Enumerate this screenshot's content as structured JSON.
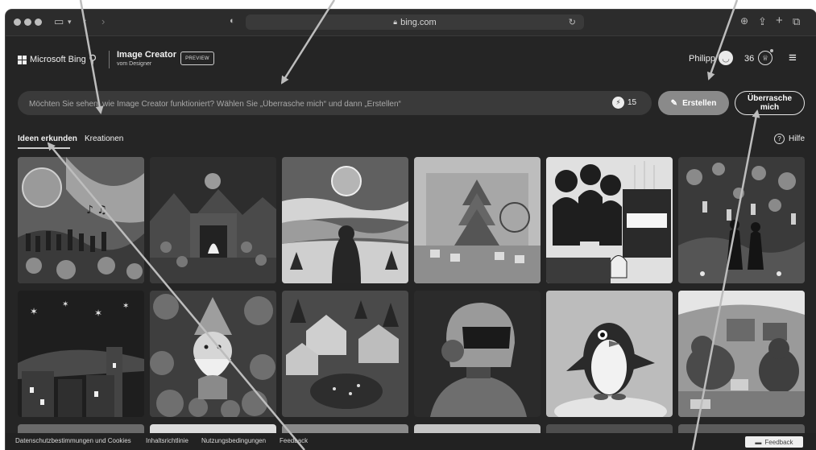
{
  "browser": {
    "url": "bing.com"
  },
  "header": {
    "brand": "Microsoft Bing",
    "product_title": "Image Creator",
    "product_subtitle": "vom Designer",
    "badge": "PREVIEW",
    "user_name": "Philipp",
    "points": "36"
  },
  "prompt": {
    "placeholder": "Möchten Sie sehen, wie Image Creator funktioniert? Wählen Sie „Überrasche mich“ und dann „Erstellen“",
    "boosts": "15",
    "create_label": "Erstellen",
    "surprise_label": "Überrasche mich"
  },
  "tabs": [
    {
      "label": "Ideen erkunden",
      "active": true
    },
    {
      "label": "Kreationen",
      "active": false
    }
  ],
  "help_label": "Hilfe",
  "gallery": {
    "images": [
      {
        "name": "space-concert-image"
      },
      {
        "name": "papercraft-campfire-image"
      },
      {
        "name": "winter-moon-figure-image"
      },
      {
        "name": "miniature-christmas-village-image"
      },
      {
        "name": "women-singing-at-piano-image"
      },
      {
        "name": "lantern-garden-couple-image"
      },
      {
        "name": "starry-night-town-image"
      },
      {
        "name": "santa-ornaments-image"
      },
      {
        "name": "snowy-village-square-image"
      },
      {
        "name": "robot-portrait-image"
      },
      {
        "name": "cartoon-penguin-image"
      },
      {
        "name": "bears-in-den-image"
      }
    ]
  },
  "footer": {
    "links": [
      "Datenschutzbestimmungen und Cookies",
      "Inhaltsrichtlinie",
      "Nutzungsbedingungen",
      "Feedback"
    ],
    "feedback_button": "Feedback"
  },
  "colors": {
    "page_background": "#252525",
    "prompt_background": "#3a3a3a",
    "create_button": "#8a8a8a",
    "annotation_arrows": "#bdbdbd"
  }
}
